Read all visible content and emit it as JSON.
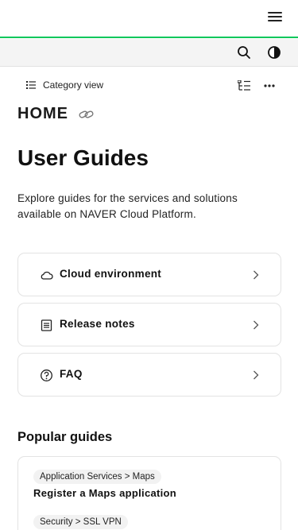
{
  "header": {
    "menu_icon": "hamburger-menu-icon",
    "accent_color": "#03c75a"
  },
  "toolbar": {
    "search_icon": "search-icon",
    "theme_icon": "contrast-icon"
  },
  "category": {
    "view_label": "Category view",
    "tree_icon": "tree-icon",
    "more_icon": "more-icon"
  },
  "page": {
    "home_label": "HOME",
    "link_icon": "link-icon",
    "title": "User Guides",
    "description": "Explore guides for the services and solutions available on NAVER Cloud Platform."
  },
  "cards": [
    {
      "label": "Cloud environment",
      "icon": "cloud-icon"
    },
    {
      "label": "Release notes",
      "icon": "document-icon"
    },
    {
      "label": "FAQ",
      "icon": "question-icon"
    }
  ],
  "popular": {
    "title": "Popular guides",
    "items": [
      {
        "breadcrumb": "Application Services > Maps",
        "title": "Register a Maps application"
      },
      {
        "breadcrumb": "Security > SSL VPN"
      }
    ]
  }
}
